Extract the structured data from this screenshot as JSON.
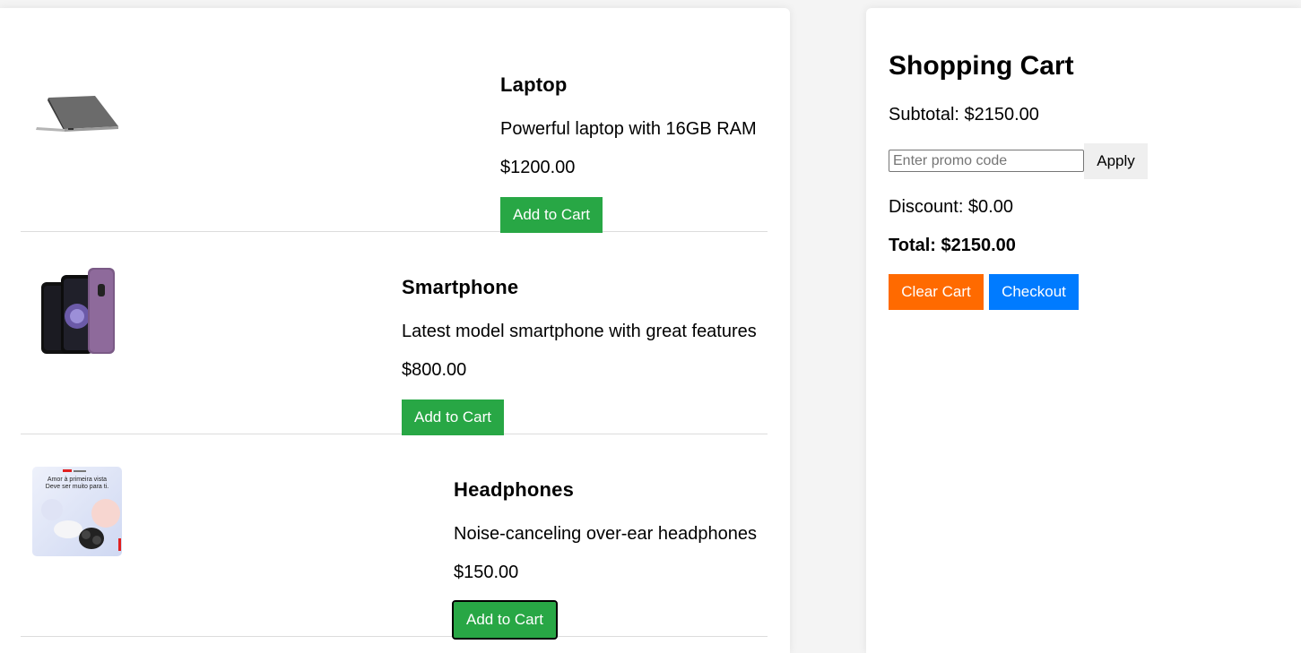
{
  "products": [
    {
      "name": "Laptop",
      "description": "Powerful laptop with 16GB RAM",
      "price": "$1200.00",
      "button_label": "Add to Cart",
      "image_icon": "laptop-image"
    },
    {
      "name": "Smartphone",
      "description": "Latest model smartphone with great features",
      "price": "$800.00",
      "button_label": "Add to Cart",
      "image_icon": "smartphone-image"
    },
    {
      "name": "Headphones",
      "description": "Noise-canceling over-ear headphones",
      "price": "$150.00",
      "button_label": "Add to Cart",
      "image_icon": "headphones-ad-image",
      "image_text": [
        "Amor à primeira vista",
        "Deve ser muito para ti."
      ]
    }
  ],
  "cart": {
    "title": "Shopping Cart",
    "subtotal": "Subtotal: $2150.00",
    "promo_placeholder": "Enter promo code",
    "promo_value": "",
    "apply_label": "Apply",
    "discount": "Discount: $0.00",
    "total": "Total: $2150.00",
    "clear_label": "Clear Cart",
    "checkout_label": "Checkout"
  },
  "colors": {
    "add_to_cart": "#28a745",
    "clear_cart": "#ff6a00",
    "checkout": "#007bff",
    "apply": "#efefef"
  }
}
